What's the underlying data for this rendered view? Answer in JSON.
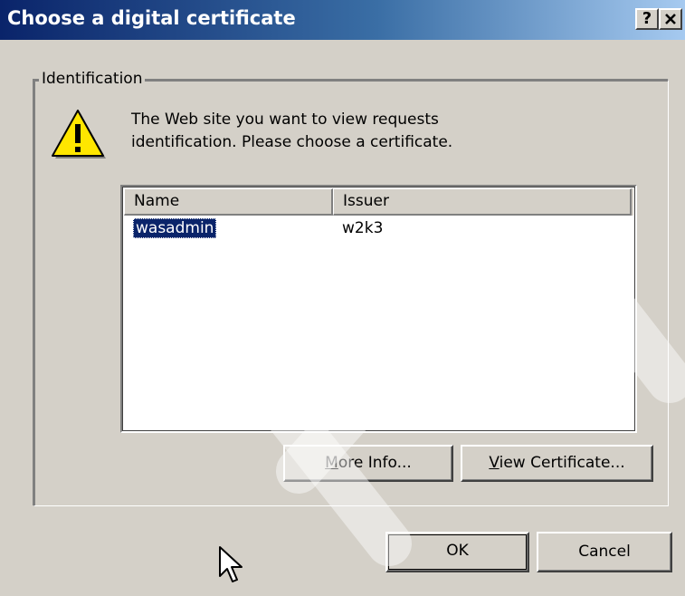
{
  "window": {
    "title": "Choose a digital certificate",
    "help_label": "?",
    "close_label": "✕"
  },
  "group": {
    "label": "Identification"
  },
  "message": {
    "line1": "The Web site you want to view requests",
    "line2": "identification. Please choose a certificate."
  },
  "certificate_list": {
    "columns": [
      "Name",
      "Issuer"
    ],
    "rows": [
      {
        "name": "wasadmin",
        "issuer": "w2k3",
        "selected": true
      }
    ]
  },
  "buttons": {
    "more_info": {
      "mnemonic": "M",
      "rest": "ore Info..."
    },
    "view_certificate": {
      "mnemonic": "V",
      "rest": "iew Certificate..."
    },
    "ok": "OK",
    "cancel": "Cancel"
  },
  "icons": {
    "warning": "warning-icon",
    "cursor": "mouse-pointer-icon"
  },
  "colors": {
    "titlebar_start": "#0a246a",
    "titlebar_end": "#a6caf0",
    "selection": "#0a246a",
    "face": "#d4d0c8"
  }
}
